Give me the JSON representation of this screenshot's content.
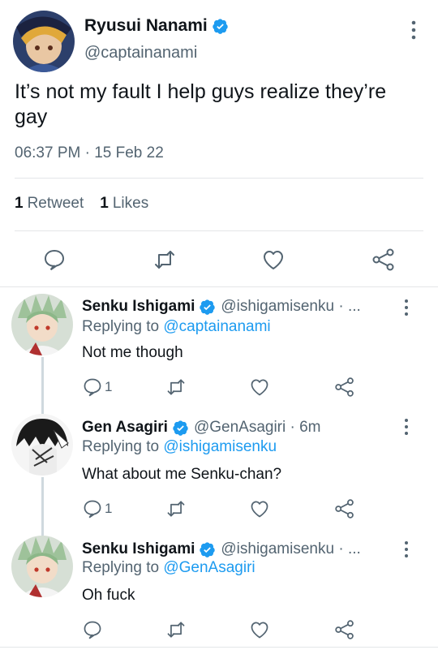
{
  "main": {
    "author_name": "Ryusui Nanami",
    "handle": "@captainanami",
    "text": "It’s not my fault I help guys realize they’re gay",
    "timestamp": "06:37 PM · 15 Feb 22",
    "retweets_count": "1",
    "retweets_label": "Retweet",
    "likes_count": "1",
    "likes_label": "Likes"
  },
  "replies": [
    {
      "name": "Senku Ishigami",
      "handle_time": "@ishigamisenku · ...",
      "replying_prefix": "Replying to",
      "replying_to": "@captainanami",
      "text": "Not me though",
      "reply_count": "1"
    },
    {
      "name": "Gen Asagiri",
      "handle_time": "@GenAsagiri · 6m",
      "replying_prefix": "Replying to",
      "replying_to": "@ishigamisenku",
      "text": "What about me Senku-chan?",
      "reply_count": "1"
    },
    {
      "name": "Senku Ishigami",
      "handle_time": "@ishigamisenku · ...",
      "replying_prefix": "Replying to",
      "replying_to": "@GenAsagiri",
      "text": "Oh fuck",
      "reply_count": ""
    }
  ],
  "colors": {
    "accent": "#1d9bf0",
    "secondary_text": "#536471",
    "divider": "#e4e6e8"
  },
  "icons": [
    "verified-badge-icon",
    "more-options-icon",
    "reply-icon",
    "retweet-icon",
    "like-icon",
    "share-icon"
  ]
}
